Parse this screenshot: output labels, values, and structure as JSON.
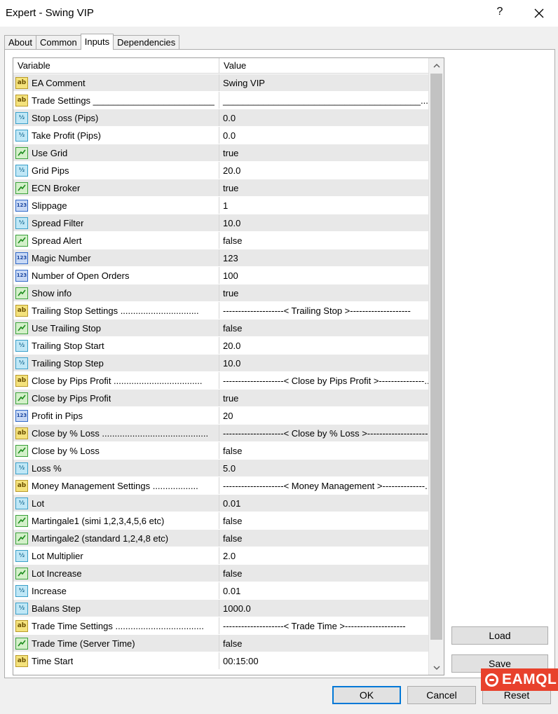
{
  "window": {
    "title": "Expert - Swing VIP",
    "help_label": "?"
  },
  "tabs": [
    {
      "label": "About",
      "active": false
    },
    {
      "label": "Common",
      "active": false
    },
    {
      "label": "Inputs",
      "active": true
    },
    {
      "label": "Dependencies",
      "active": false
    }
  ],
  "grid": {
    "columns": {
      "variable": "Variable",
      "value": "Value"
    },
    "icon_types": {
      "s": "ab",
      "d": "½",
      "b": "bool",
      "i": "123"
    },
    "rows": [
      {
        "var": "EA Comment",
        "val": "Swing VIP",
        "type": "s"
      },
      {
        "var": "Trade Settings ________________________",
        "val": "_______________________________________...",
        "type": "s"
      },
      {
        "var": "Stop Loss (Pips)",
        "val": "0.0",
        "type": "d"
      },
      {
        "var": "Take Profit (Pips)",
        "val": "0.0",
        "type": "d"
      },
      {
        "var": "Use Grid",
        "val": "true",
        "type": "b"
      },
      {
        "var": "Grid Pips",
        "val": "20.0",
        "type": "d"
      },
      {
        "var": "ECN Broker",
        "val": "true",
        "type": "b"
      },
      {
        "var": "Slippage",
        "val": "1",
        "type": "i"
      },
      {
        "var": "Spread Filter",
        "val": "10.0",
        "type": "d"
      },
      {
        "var": "Spread Alert",
        "val": "false",
        "type": "b"
      },
      {
        "var": "Magic Number",
        "val": "123",
        "type": "i"
      },
      {
        "var": "Number of Open Orders",
        "val": "100",
        "type": "i"
      },
      {
        "var": "Show info",
        "val": "true",
        "type": "b"
      },
      {
        "var": "Trailing Stop Settings ...............................",
        "val": "--------------------< Trailing Stop >--------------------",
        "type": "s"
      },
      {
        "var": "Use Trailing Stop",
        "val": "false",
        "type": "b"
      },
      {
        "var": "Trailing Stop Start",
        "val": "20.0",
        "type": "d"
      },
      {
        "var": "Trailing Stop Step",
        "val": "10.0",
        "type": "d"
      },
      {
        "var": "Close by Pips Profit ...................................",
        "val": "--------------------< Close by Pips Profit >---------------...",
        "type": "s"
      },
      {
        "var": "Close by Pips Profit",
        "val": "true",
        "type": "b"
      },
      {
        "var": "Profit in Pips",
        "val": "20",
        "type": "i"
      },
      {
        "var": "Close by % Loss ..........................................",
        "val": "--------------------< Close by % Loss >--------------------",
        "type": "s"
      },
      {
        "var": "Close by % Loss",
        "val": "false",
        "type": "b"
      },
      {
        "var": "Loss %",
        "val": "5.0",
        "type": "d"
      },
      {
        "var": "Money Management Settings ..................",
        "val": "--------------------< Money Management >--------------...",
        "type": "s"
      },
      {
        "var": "Lot",
        "val": "0.01",
        "type": "d"
      },
      {
        "var": "Martingale1 (simi 1,2,3,4,5,6 etc)",
        "val": "false",
        "type": "b"
      },
      {
        "var": "Martingale2 (standard 1,2,4,8 etc)",
        "val": "false",
        "type": "b"
      },
      {
        "var": "Lot Multiplier",
        "val": "2.0",
        "type": "d"
      },
      {
        "var": "Lot Increase",
        "val": "false",
        "type": "b"
      },
      {
        "var": "Increase",
        "val": "0.01",
        "type": "d"
      },
      {
        "var": "Balans Step",
        "val": "1000.0",
        "type": "d"
      },
      {
        "var": "Trade Time Settings ...................................",
        "val": "--------------------< Trade Time >--------------------",
        "type": "s"
      },
      {
        "var": "Trade Time (Server Time)",
        "val": "false",
        "type": "b"
      },
      {
        "var": "Time Start",
        "val": "00:15:00",
        "type": "s"
      }
    ]
  },
  "buttons": {
    "load": "Load",
    "save": "Save",
    "ok": "OK",
    "cancel": "Cancel",
    "reset": "Reset"
  },
  "watermark": {
    "text": "EAMQL"
  }
}
